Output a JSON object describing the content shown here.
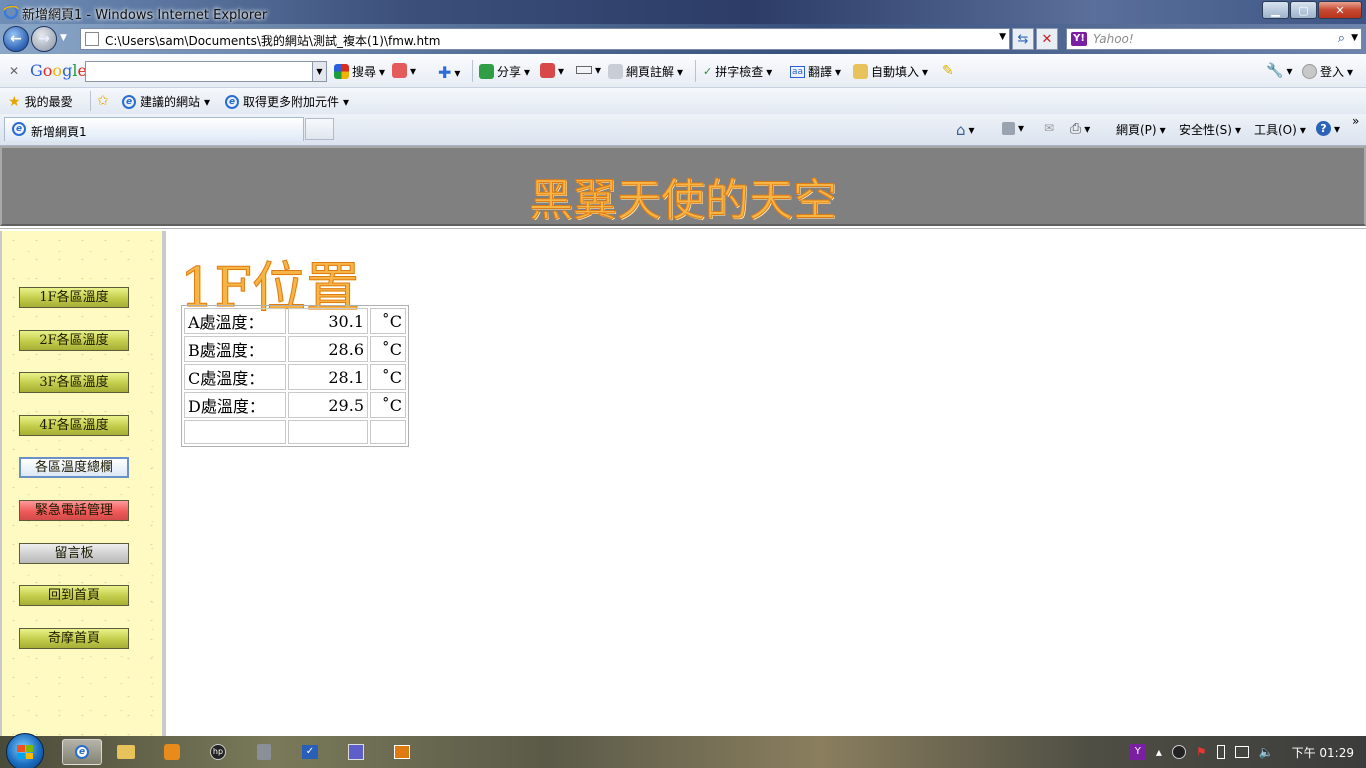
{
  "window": {
    "title": "新增網頁1 - Windows Internet Explorer"
  },
  "address": {
    "url": "C:\\Users\\sam\\Documents\\我的網站\\測試_複本(1)\\fmw.htm",
    "search_placeholder": "Yahoo!"
  },
  "google_toolbar": {
    "logo": "Google",
    "search_label": "搜尋",
    "share_label": "分享",
    "annotate_label": "網頁註解",
    "spellcheck_label": "拼字檢查",
    "translate_label": "翻譯",
    "autofill_label": "自動填入",
    "signin_label": "登入"
  },
  "favorites": {
    "label": "我的最愛",
    "items": [
      "建議的網站",
      "取得更多附加元件"
    ]
  },
  "tabs": [
    {
      "label": "新增網頁1"
    }
  ],
  "command_bar": {
    "page_label": "網頁(P)",
    "safety_label": "安全性(S)",
    "tools_label": "工具(O)"
  },
  "page": {
    "banner_title": "黑翼天使的天空",
    "heading": "1F位置",
    "nav_buttons": [
      "1F各區溫度",
      "2F各區溫度",
      "3F各區溫度",
      "4F各區溫度",
      "各區溫度總欄",
      "緊急電話管理",
      "留言板",
      "回到首頁",
      "奇摩首頁"
    ],
    "table": [
      {
        "label": "A處溫度：",
        "value": "30.1",
        "unit": "˚C"
      },
      {
        "label": "B處溫度：",
        "value": "28.6",
        "unit": "˚C"
      },
      {
        "label": "C處溫度：",
        "value": "28.1",
        "unit": "˚C"
      },
      {
        "label": "D處溫度：",
        "value": "29.5",
        "unit": "˚C"
      },
      {
        "label": "",
        "value": "",
        "unit": ""
      }
    ]
  },
  "taskbar": {
    "clock": "下午 01:29"
  }
}
